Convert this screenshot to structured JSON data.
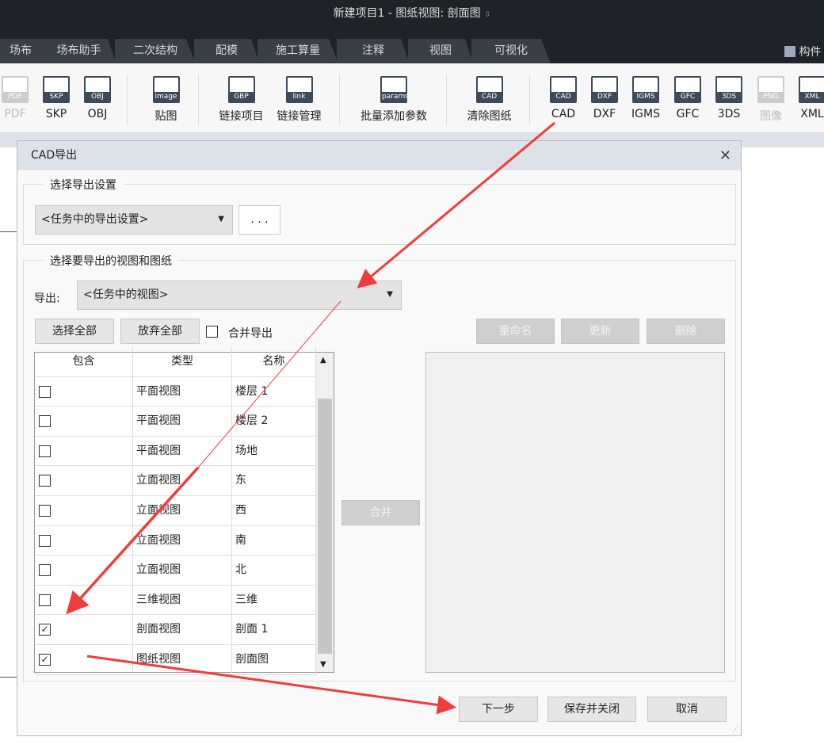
{
  "window": {
    "title": "新建项目1 - 图纸视图: 剖面图",
    "title_suffix": "⇳"
  },
  "tabs": [
    "场布",
    "场布助手",
    "二次结构",
    "配模",
    "施工算量",
    "注释",
    "视图",
    "可视化"
  ],
  "top_right": {
    "label": "构件"
  },
  "ribbon": [
    {
      "label": "PDF",
      "icon": "PDF",
      "disabled": true
    },
    {
      "label": "SKP",
      "icon": "SKP"
    },
    {
      "label": "OBJ",
      "icon": "OBJ"
    },
    {
      "label": "贴图",
      "icon": "image"
    },
    {
      "label": "链接项目",
      "icon": "GBP"
    },
    {
      "label": "链接管理",
      "icon": "link"
    },
    {
      "label": "批量添加参数",
      "icon": "params"
    },
    {
      "label": "清除图纸",
      "icon": "CAD"
    },
    {
      "label": "CAD",
      "icon": "CAD"
    },
    {
      "label": "DXF",
      "icon": "DXF"
    },
    {
      "label": "IGMS",
      "icon": "IGMS"
    },
    {
      "label": "GFC",
      "icon": "GFC"
    },
    {
      "label": "3DS",
      "icon": "3DS"
    },
    {
      "label": "图像",
      "icon": "PNG",
      "disabled": true
    },
    {
      "label": "XML",
      "icon": "XML"
    }
  ],
  "dialog": {
    "title": "CAD导出",
    "close": "✕",
    "settings_group": "选择导出设置",
    "settings_value": "<任务中的导出设置>",
    "more_button": ". . .",
    "views_group": "选择要导出的视图和图纸",
    "export_label": "导出:",
    "export_value": "<任务中的视图>",
    "select_all": "选择全部",
    "deselect_all": "放弃全部",
    "merge_export": "合并导出",
    "rename": "重命名",
    "update": "更新",
    "delete": "删除",
    "merge": "合并",
    "columns": [
      "包含",
      "类型",
      "名称"
    ],
    "rows": [
      {
        "checked": false,
        "type": "平面视图",
        "name": "楼层 1"
      },
      {
        "checked": false,
        "type": "平面视图",
        "name": "楼层 2"
      },
      {
        "checked": false,
        "type": "平面视图",
        "name": "场地"
      },
      {
        "checked": false,
        "type": "立面视图",
        "name": "东"
      },
      {
        "checked": false,
        "type": "立面视图",
        "name": "西"
      },
      {
        "checked": false,
        "type": "立面视图",
        "name": "南"
      },
      {
        "checked": false,
        "type": "立面视图",
        "name": "北"
      },
      {
        "checked": false,
        "type": "三维视图",
        "name": "三维"
      },
      {
        "checked": true,
        "type": "剖面视图",
        "name": "剖面 1"
      },
      {
        "checked": true,
        "type": "图纸视图",
        "name": "剖面图"
      }
    ],
    "next": "下一步",
    "save_close": "保存并关闭",
    "cancel": "取消"
  },
  "colors": {
    "annotation_arrow": "#f03c3c",
    "titlebar": "#1f2328"
  }
}
